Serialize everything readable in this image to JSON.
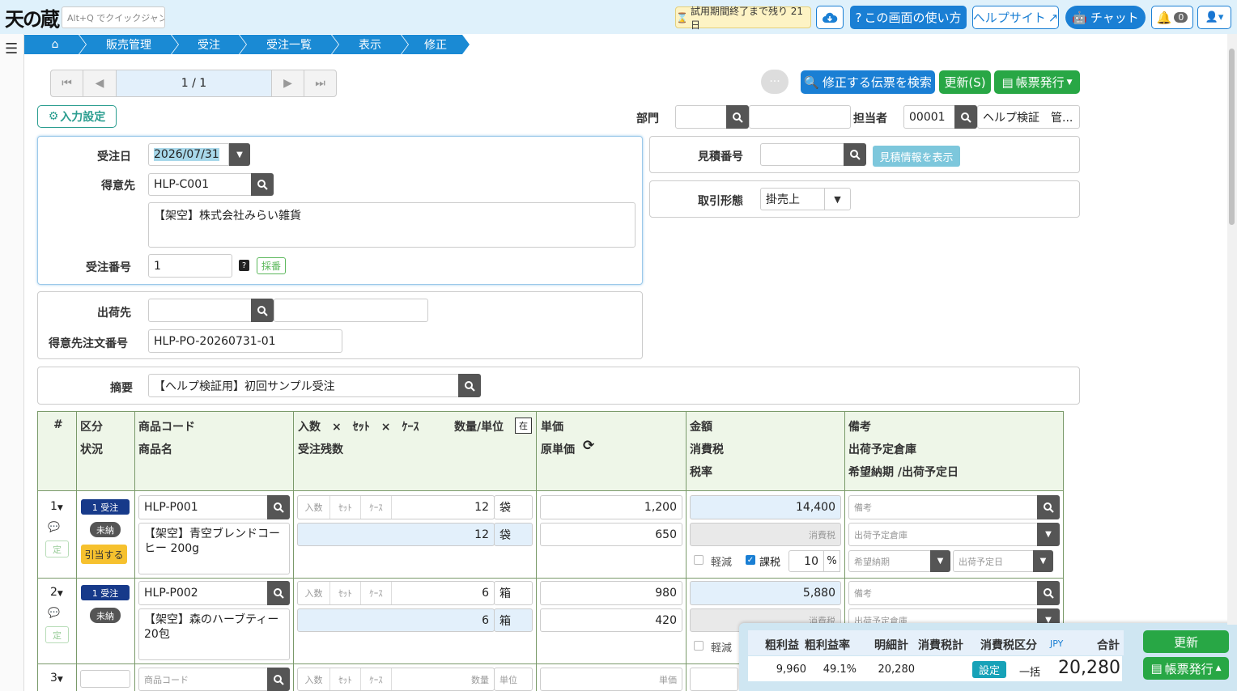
{
  "app": {
    "logo": "天の蔵",
    "jump_placeholder": "Alt+Q でクイックジャンプ"
  },
  "topbar": {
    "trial": "試用期間終了まで残り 21日",
    "howto": "この画面の使い方",
    "helpsite": "ヘルプサイト",
    "chat": "チャット",
    "notif_count": "0"
  },
  "breadcrumb": [
    "販売管理",
    "受注",
    "受注一覧",
    "表示",
    "修正"
  ],
  "pager": {
    "page": "1 / 1"
  },
  "actions": {
    "search_slip": "修正する伝票を検索",
    "update": "更新(S)",
    "issue": "帳票発行"
  },
  "input_settings": "入力設定",
  "header": {
    "dept_label": "部門",
    "dept_code": "",
    "dept_name": "",
    "staff_label": "担当者",
    "staff_code": "00001",
    "staff_name": "ヘルプ検証　管...",
    "order_date_label": "受注日",
    "order_date": "2026/07/31",
    "customer_label": "得意先",
    "customer_code": "HLP-C001",
    "customer_name": "【架空】株式会社みらい雑貨",
    "order_no_label": "受注番号",
    "order_no": "1",
    "numbering": "採番",
    "quote_label": "見積番号",
    "quote_no": "",
    "quote_show": "見積情報を表示",
    "trade_label": "取引形態",
    "trade_type": "掛売上",
    "ship_label": "出荷先",
    "ship_code": "",
    "ship_name": "",
    "po_label": "得意先注文番号",
    "po_no": "HLP-PO-20260731-01",
    "memo_label": "摘要",
    "memo": "【ヘルプ検証用】初回サンプル受注"
  },
  "grid_head": {
    "no": "#",
    "kubun": "区分",
    "status": "状況",
    "code": "商品コード",
    "name": "商品名",
    "qty": "入数　×　ｾｯﾄ　×　ｹｰｽ",
    "qty_unit": "数量/単位",
    "zai": "在",
    "remain": "受注残数",
    "price": "単価",
    "cost": "原単価",
    "amount": "金額",
    "tax": "消費税",
    "rate": "税率",
    "remark": "備考",
    "warehouse": "出荷予定倉庫",
    "dates": "希望納期 /出荷予定日"
  },
  "row_ph": {
    "irisu": "入数",
    "set": "ｾｯﾄ",
    "case": "ｹｰｽ",
    "tax": "消費税",
    "remark": "備考",
    "warehouse": "出荷予定倉庫",
    "wish": "希望納期",
    "shipdate": "出荷予定日",
    "code": "商品コード",
    "qty": "数量",
    "unit": "単位",
    "price": "単価",
    "light": "軽減",
    "taxable": "課税",
    "pct": "%"
  },
  "rows": [
    {
      "no": "1",
      "kubun": "1 受注",
      "status": "未納",
      "alloc": "引当する",
      "fix": "定",
      "code": "HLP-P001",
      "name": "【架空】青空ブレンドコーヒー 200g",
      "qty": "12",
      "unit": "袋",
      "remain": "12",
      "remain_unit": "袋",
      "price": "1,200",
      "cost": "650",
      "amount": "14,400",
      "rate": "10"
    },
    {
      "no": "2",
      "kubun": "1 受注",
      "status": "未納",
      "fix": "定",
      "code": "HLP-P002",
      "name": "【架空】森のハーブティー 20包",
      "qty": "6",
      "unit": "箱",
      "remain": "6",
      "remain_unit": "箱",
      "price": "980",
      "cost": "420",
      "amount": "5,880"
    },
    {
      "no": "3"
    }
  ],
  "summary": {
    "h_profit": "粗利益",
    "h_rate": "粗利益率",
    "h_subtotal": "明細計",
    "h_taxsum": "消費税計",
    "h_taxkind": "消費税区分",
    "h_jpy": "JPY",
    "h_total": "合計",
    "profit": "9,960",
    "rate": "49.1%",
    "subtotal": "20,280",
    "taxsum": "",
    "setting": "設定",
    "taxkind": "一括",
    "total": "20,280",
    "update": "更新",
    "issue": "帳票発行"
  }
}
